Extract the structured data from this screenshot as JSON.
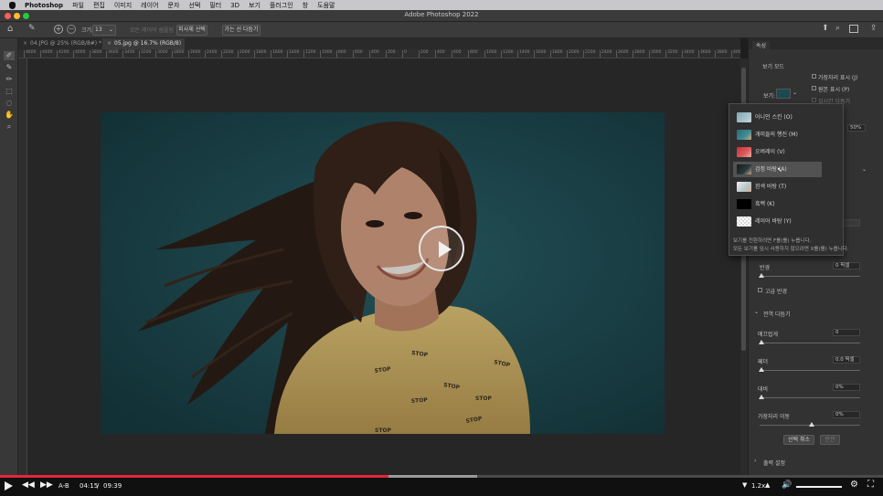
{
  "menubar": {
    "app": "Photoshop",
    "items": [
      "파일",
      "편집",
      "이미지",
      "레이어",
      "문자",
      "선택",
      "필터",
      "3D",
      "보기",
      "플러그인",
      "창",
      "도움말"
    ]
  },
  "window": {
    "title": "Adobe Photoshop 2022"
  },
  "options_bar": {
    "size_label": "크기:",
    "size_value": "13",
    "sample_all_layers": "모든 레이어 샘플링",
    "select_subject": "피사체 선택",
    "select_and_mask": "가는 선 다듬기"
  },
  "tabs": [
    {
      "label": "04.JPG @ 25% (RGB/8#) *"
    },
    {
      "label": "05.jpg @ 16.7% (RGB/8)"
    }
  ],
  "ruler_ticks": [
    "4600",
    "4400",
    "4200",
    "4000",
    "3800",
    "3600",
    "3400",
    "3200",
    "3000",
    "2800",
    "2600",
    "2400",
    "2200",
    "2000",
    "1800",
    "1600",
    "1400",
    "1200",
    "1000",
    "800",
    "600",
    "400",
    "200",
    "0",
    "200",
    "400",
    "600",
    "800",
    "1000",
    "1200",
    "1400",
    "1600",
    "1800",
    "2000",
    "2200",
    "2400",
    "2600",
    "2800",
    "3000",
    "3200",
    "3400",
    "3600",
    "3800",
    "4000"
  ],
  "properties": {
    "tab": "속성",
    "view_mode_title": "보기 모드",
    "view_label": "보기:",
    "show_edge": "가장자리 표시 (J)",
    "show_original": "원본 표시 (P)",
    "realtime_refine": "실시간 다듬기",
    "opacity_value": "50%",
    "radius_label": "반경",
    "radius_value": "0 픽셀",
    "smart_radius": "고급 반경",
    "global_refine_title": "전역 다듬기",
    "smooth_label": "매끄럽게",
    "smooth_value": "0",
    "feather_label": "페더",
    "feather_value": "0.0 픽셀",
    "contrast_label": "대비",
    "contrast_value": "0%",
    "shift_edge_label": "가장자리 이동",
    "shift_edge_value": "0%",
    "clear_selection": "선택 취소",
    "invert": "반전",
    "output_settings": "출력 설정"
  },
  "view_menu": {
    "items": [
      {
        "label": "어니언 스킨 (O)",
        "thumb": "onion"
      },
      {
        "label": "개미들의 행진 (M)",
        "thumb": "ants"
      },
      {
        "label": "오버레이 (V)",
        "thumb": "overlay"
      },
      {
        "label": "검정 바탕 (A)",
        "thumb": "black-bg",
        "selected": true
      },
      {
        "label": "흰색 바탕 (T)",
        "thumb": "white-bg"
      },
      {
        "label": "흑백 (K)",
        "thumb": "bw"
      },
      {
        "label": "레이어 바탕 (Y)",
        "thumb": "layer"
      }
    ],
    "tip1": "보기를 전환하려면 F를(를) 누릅니다.",
    "tip2": "모든 보기를 임시 사용하지 않으려면 X를(를) 누릅니다."
  },
  "video": {
    "ab_label": "A-B",
    "current_time": "04:15",
    "separator": "/",
    "duration": "09:39",
    "speed": "1.2x",
    "progress_fraction": 0.44,
    "buffered_fraction": 0.54,
    "accent_color": "#e3263d"
  }
}
